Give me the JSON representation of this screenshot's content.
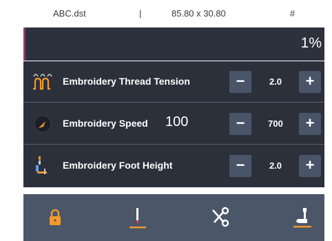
{
  "info": {
    "filename": "ABC.dst",
    "separator": "|",
    "dimensions": "85.80 x 30.80",
    "hash": "#"
  },
  "progress": {
    "text": "1%"
  },
  "settings": [
    {
      "label": "Embroidery Thread Tension",
      "value": "2.0",
      "icon": "thread-tension-icon"
    },
    {
      "label": "Embroidery Speed",
      "big_value": "100",
      "value": "700",
      "icon": "speed-gauge-icon"
    },
    {
      "label": "Embroidery Foot Height",
      "value": "2.0",
      "icon": "foot-height-icon"
    }
  ],
  "buttons": {
    "minus": "−",
    "plus": "+"
  },
  "bottom_bar": [
    {
      "name": "lock-icon"
    },
    {
      "name": "needle-icon"
    },
    {
      "name": "scissors-icon"
    },
    {
      "name": "presser-foot-icon"
    }
  ],
  "colors": {
    "panel": "#2b303b",
    "button": "#4a5468",
    "bottom_bar": "#4c5669",
    "accent_orange": "#f39a2b",
    "progress_accent": "#8a3a6e"
  }
}
